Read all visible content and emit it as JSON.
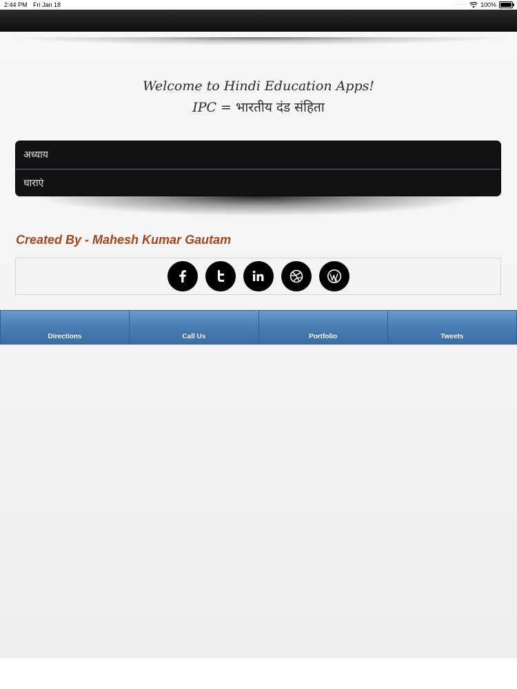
{
  "status_bar": {
    "time": "2:44 PM",
    "date": "Fri Jan 18",
    "battery": "100%",
    "battery_level": 1.0
  },
  "header": {
    "welcome_line1": "Welcome to Hindi Education Apps!",
    "welcome_ipc": "IPC",
    "welcome_eq": " = भारतीय दंड संहिता"
  },
  "menu": {
    "items": [
      {
        "label": "अध्याय"
      },
      {
        "label": "धाराएं"
      }
    ]
  },
  "credits": {
    "text": "Created By - Mahesh Kumar Gautam",
    "color": "#a4471a"
  },
  "social": {
    "icons": [
      "facebook-icon",
      "twitter-icon",
      "linkedin-icon",
      "dribbble-icon",
      "wordpress-icon"
    ]
  },
  "tabs": {
    "items": [
      {
        "label": "Directions"
      },
      {
        "label": "Call Us"
      },
      {
        "label": "Portfolio"
      },
      {
        "label": "Tweets"
      }
    ],
    "color": "#4a7fb5"
  }
}
